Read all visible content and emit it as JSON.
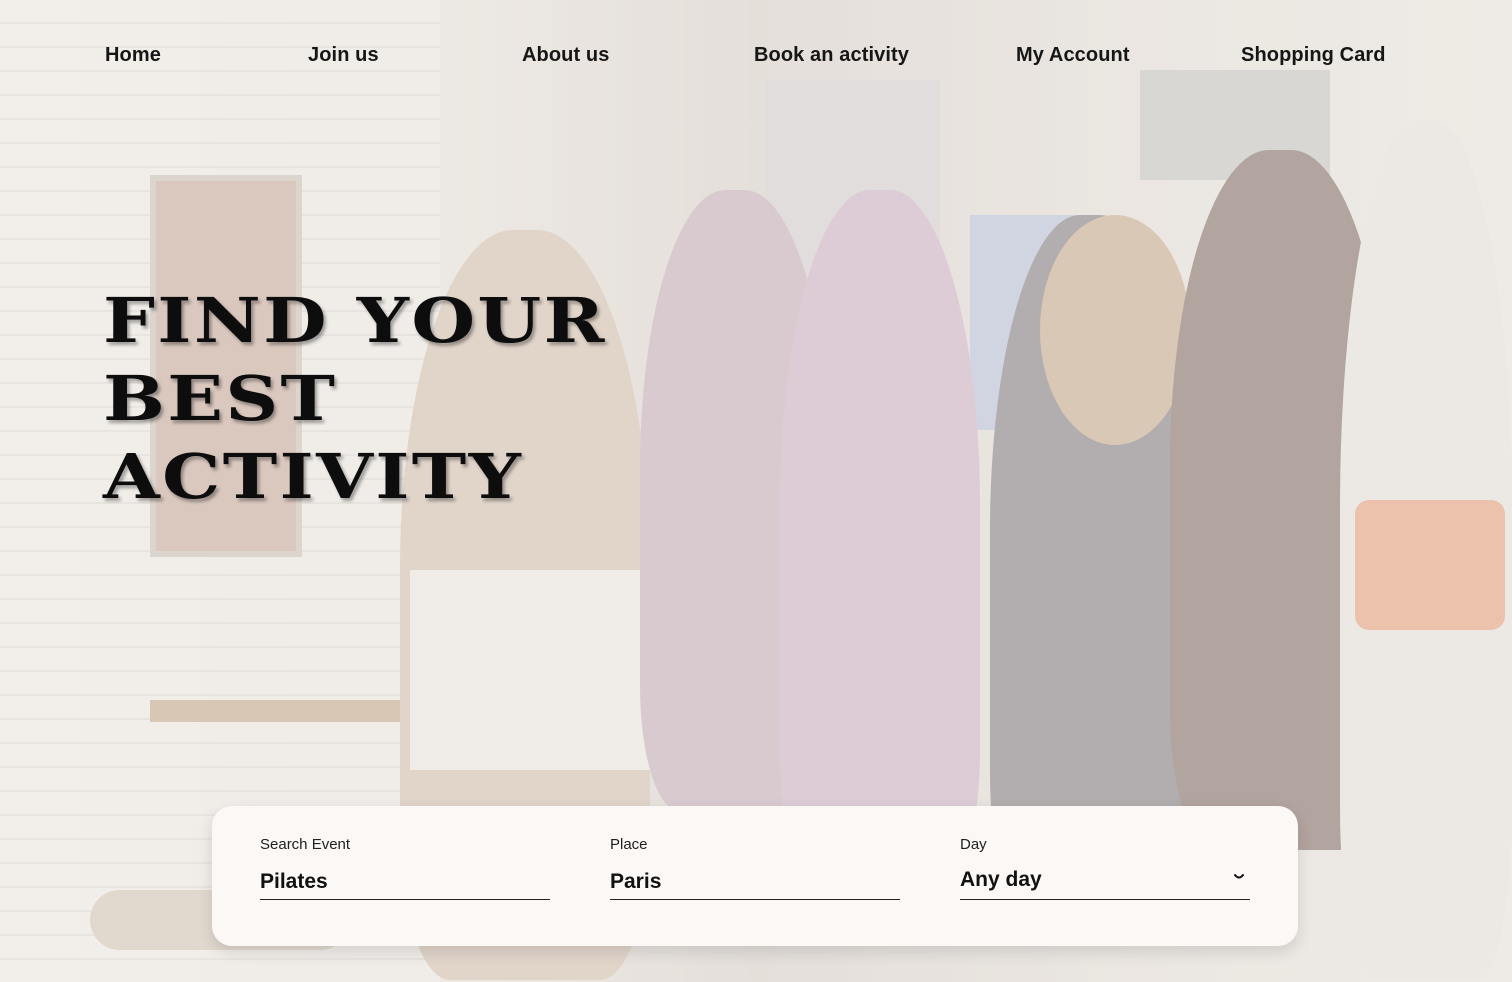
{
  "nav": {
    "items": [
      {
        "label": "Home"
      },
      {
        "label": "Join us"
      },
      {
        "label": "About us"
      },
      {
        "label": "Book an activity"
      },
      {
        "label": "My Account"
      },
      {
        "label": "Shopping Card"
      }
    ]
  },
  "hero": {
    "headline": [
      "FIND YOUR",
      "BEST",
      "ACTIVITY"
    ]
  },
  "search": {
    "event": {
      "label": "Search Event",
      "value": "Pilates"
    },
    "place": {
      "label": "Place",
      "value": "Paris"
    },
    "day": {
      "label": "Day",
      "value": "Any day",
      "icon": "chevron-down-icon"
    }
  },
  "colors": {
    "text": "#161616",
    "card": "#fcf8f5",
    "headline": "#0d0d0d"
  }
}
